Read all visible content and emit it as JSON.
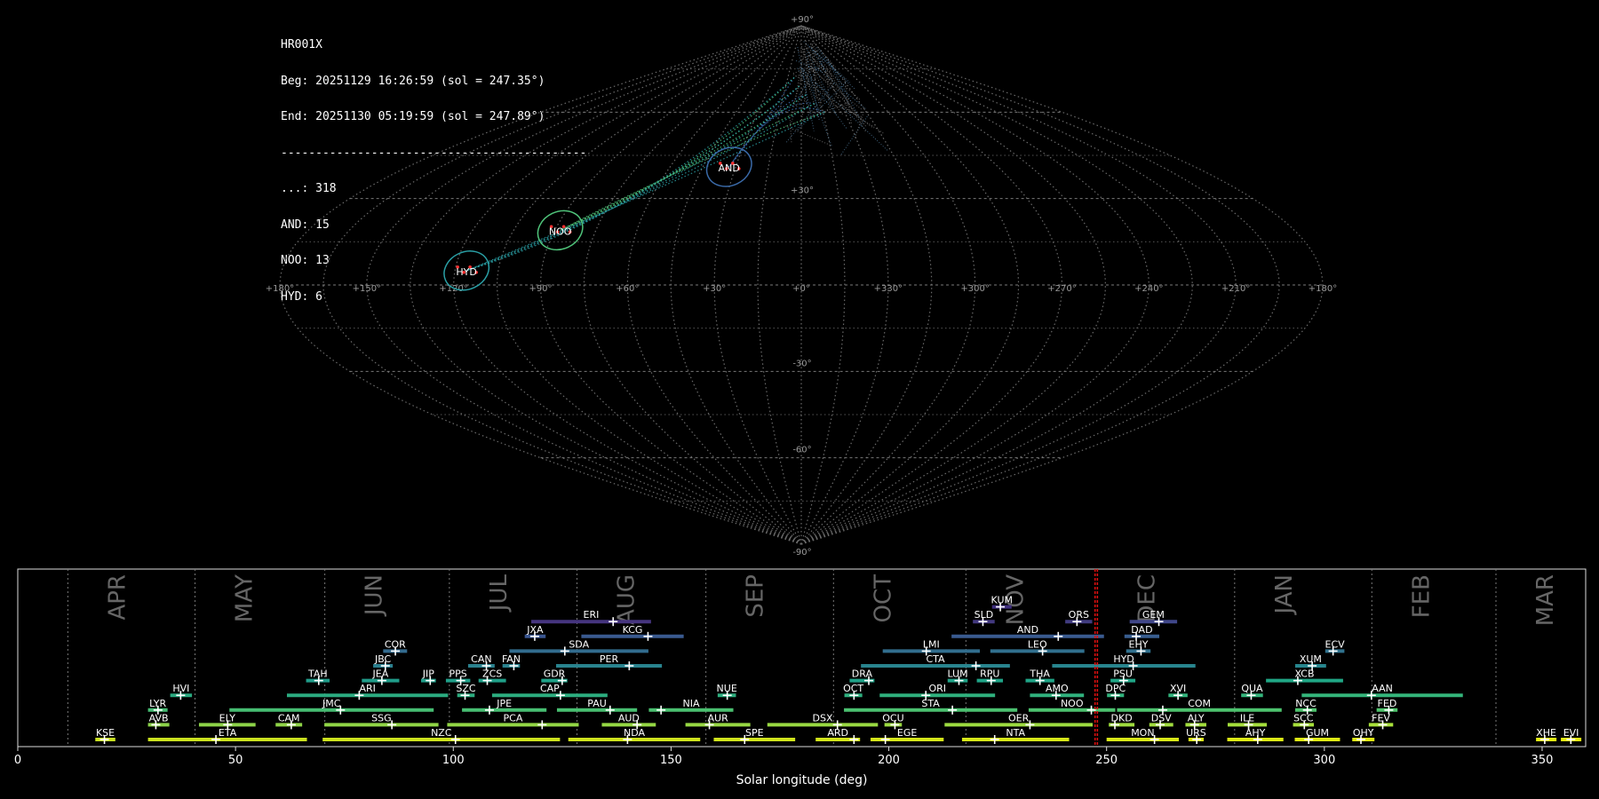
{
  "header": {
    "station": "HR001X",
    "begin": "Beg: 20251129 16:26:59 (sol = 247.35°)",
    "end": "End: 20251130 05:19:59 (sol = 247.89°)",
    "separator": "--------------------------------------------"
  },
  "chart_data": [
    {
      "type": "scatter",
      "projection": "sinusoidal",
      "counts": [
        {
          "label": "...",
          "count": 318
        },
        {
          "label": "AND",
          "count": 15
        },
        {
          "label": "NOO",
          "count": 13
        },
        {
          "label": "HYD",
          "count": 6
        }
      ],
      "radiants": [
        {
          "name": "AND",
          "lon": 33,
          "lat": 41,
          "color": "#3a6aa8"
        },
        {
          "name": "NOO",
          "lon": 88,
          "lat": 19,
          "color": "#4fc47a"
        },
        {
          "name": "HYD",
          "lon": 116,
          "lat": 5,
          "color": "#2aa0a6"
        }
      ],
      "lon_ticks": [
        "+180°",
        "+150°",
        "+120°",
        "+90°",
        "+60°",
        "+30°",
        "+0°",
        "+330°",
        "+300°",
        "+270°",
        "+240°",
        "+210°",
        "+180°"
      ],
      "lon_values": [
        180,
        150,
        120,
        90,
        60,
        30,
        0,
        -30,
        -60,
        -90,
        -120,
        -150,
        -180
      ],
      "lat_ticks": [
        "+90°",
        "+30°",
        "-30°",
        "-60°",
        "-90°"
      ],
      "lat_values": [
        90,
        30,
        -30,
        -60,
        -90
      ]
    },
    {
      "type": "timeline",
      "xlabel": "Solar longitude (deg)",
      "xlim": [
        0,
        360
      ],
      "xticks": [
        0,
        50,
        100,
        150,
        200,
        250,
        300,
        350
      ],
      "current_sol": [
        247.35,
        247.89
      ],
      "months": [
        {
          "name": "APR",
          "start": 11.5
        },
        {
          "name": "MAY",
          "start": 40.7
        },
        {
          "name": "JUN",
          "start": 70.5
        },
        {
          "name": "JUL",
          "start": 99.1
        },
        {
          "name": "AUG",
          "start": 128.4
        },
        {
          "name": "SEP",
          "start": 158.0
        },
        {
          "name": "OCT",
          "start": 187.3
        },
        {
          "name": "NOV",
          "start": 217.7
        },
        {
          "name": "DEC",
          "start": 247.9
        },
        {
          "name": "JAN",
          "start": 279.4
        },
        {
          "name": "FEB",
          "start": 310.9
        },
        {
          "name": "MAR",
          "start": 339.4
        }
      ],
      "showers": [
        {
          "code": "KUM",
          "start": 223.7,
          "end": 228.2,
          "peak": 225.6,
          "row": 9,
          "color": "#3f2f7f"
        },
        {
          "code": "ERI",
          "start": 117.9,
          "end": 145.4,
          "peak": 136.7,
          "row": 8,
          "color": "#46357f"
        },
        {
          "code": "SLD",
          "start": 219.3,
          "end": 224.3,
          "peak": 221.6,
          "row": 8,
          "color": "#433980"
        },
        {
          "code": "ORS",
          "start": 240.5,
          "end": 246.7,
          "peak": 243.2,
          "row": 8,
          "color": "#413c80"
        },
        {
          "code": "GEM",
          "start": 255.3,
          "end": 266.2,
          "peak": 262.0,
          "row": 8,
          "color": "#40478a"
        },
        {
          "code": "JXA",
          "start": 116.4,
          "end": 121.2,
          "peak": 118.7,
          "row": 7,
          "color": "#3a5690"
        },
        {
          "code": "KCG",
          "start": 129.4,
          "end": 152.9,
          "peak": 144.7,
          "row": 7,
          "color": "#3a5a90"
        },
        {
          "code": "AND",
          "start": 214.4,
          "end": 249.4,
          "peak": 238.9,
          "row": 7,
          "color": "#3a5b90"
        },
        {
          "code": "DAD",
          "start": 254.1,
          "end": 262.1,
          "peak": 256.8,
          "row": 7,
          "color": "#395e90"
        },
        {
          "code": "COR",
          "start": 83.9,
          "end": 89.4,
          "peak": 86.7,
          "row": 6,
          "color": "#336b8f"
        },
        {
          "code": "SDA",
          "start": 112.9,
          "end": 144.8,
          "peak": 125.6,
          "row": 6,
          "color": "#326c8e"
        },
        {
          "code": "LMI",
          "start": 198.6,
          "end": 220.9,
          "peak": 208.6,
          "row": 6,
          "color": "#326e8e"
        },
        {
          "code": "LEO",
          "start": 223.3,
          "end": 244.9,
          "peak": 235.3,
          "row": 6,
          "color": "#31708e"
        },
        {
          "code": "EHY",
          "start": 254.5,
          "end": 260.1,
          "peak": 257.9,
          "row": 6,
          "color": "#31718e"
        },
        {
          "code": "ECV",
          "start": 300.2,
          "end": 304.6,
          "peak": 302.0,
          "row": 6,
          "color": "#30728e"
        },
        {
          "code": "JBC",
          "start": 81.6,
          "end": 86.1,
          "peak": 84.4,
          "row": 5,
          "color": "#2b7f8e"
        },
        {
          "code": "CAN",
          "start": 103.4,
          "end": 109.5,
          "peak": 107.6,
          "row": 5,
          "color": "#2a818e"
        },
        {
          "code": "FAN",
          "start": 111.3,
          "end": 115.3,
          "peak": 113.9,
          "row": 5,
          "color": "#2a828e"
        },
        {
          "code": "PER",
          "start": 123.6,
          "end": 147.9,
          "peak": 140.4,
          "row": 5,
          "color": "#29838e"
        },
        {
          "code": "CTA",
          "start": 193.6,
          "end": 227.8,
          "peak": 220.0,
          "row": 5,
          "color": "#29848e"
        },
        {
          "code": "HYD",
          "start": 237.5,
          "end": 270.4,
          "peak": 256.1,
          "row": 5,
          "color": "#28858e"
        },
        {
          "code": "XUM",
          "start": 293.3,
          "end": 300.4,
          "peak": 297.2,
          "row": 5,
          "color": "#27868e"
        },
        {
          "code": "TAH",
          "start": 66.2,
          "end": 71.6,
          "peak": 69.1,
          "row": 4,
          "color": "#209b89"
        },
        {
          "code": "JEA",
          "start": 79.0,
          "end": 87.6,
          "peak": 83.6,
          "row": 4,
          "color": "#209c89"
        },
        {
          "code": "JIP",
          "start": 92.6,
          "end": 96.0,
          "peak": 94.7,
          "row": 4,
          "color": "#1f9d88"
        },
        {
          "code": "PPS",
          "start": 98.3,
          "end": 103.9,
          "peak": 101.7,
          "row": 4,
          "color": "#1f9e88"
        },
        {
          "code": "ZCS",
          "start": 105.8,
          "end": 112.1,
          "peak": 107.8,
          "row": 4,
          "color": "#1f9f88"
        },
        {
          "code": "GDR",
          "start": 120.2,
          "end": 126.2,
          "peak": 125.0,
          "row": 4,
          "color": "#1fa087"
        },
        {
          "code": "DRA",
          "start": 191.0,
          "end": 196.7,
          "peak": 195.4,
          "row": 4,
          "color": "#1fa187"
        },
        {
          "code": "LUM",
          "start": 213.5,
          "end": 218.1,
          "peak": 216.1,
          "row": 4,
          "color": "#1fa287"
        },
        {
          "code": "RPU",
          "start": 220.2,
          "end": 226.2,
          "peak": 223.5,
          "row": 4,
          "color": "#1fa386"
        },
        {
          "code": "THA",
          "start": 231.4,
          "end": 238.0,
          "peak": 234.7,
          "row": 4,
          "color": "#1fa486"
        },
        {
          "code": "PSU",
          "start": 250.9,
          "end": 256.6,
          "peak": 253.9,
          "row": 4,
          "color": "#20a586"
        },
        {
          "code": "XCB",
          "start": 286.6,
          "end": 304.3,
          "peak": 293.9,
          "row": 4,
          "color": "#20a685"
        },
        {
          "code": "HVI",
          "start": 35.0,
          "end": 40.0,
          "peak": 37.4,
          "row": 3,
          "color": "#2aaa80"
        },
        {
          "code": "ARI",
          "start": 61.8,
          "end": 98.8,
          "peak": 78.4,
          "row": 3,
          "color": "#2bab80"
        },
        {
          "code": "SZC",
          "start": 100.9,
          "end": 104.9,
          "peak": 102.7,
          "row": 3,
          "color": "#2cac7f"
        },
        {
          "code": "CAP",
          "start": 108.9,
          "end": 135.4,
          "peak": 124.6,
          "row": 3,
          "color": "#2cad7f"
        },
        {
          "code": "NUE",
          "start": 160.7,
          "end": 164.9,
          "peak": 162.9,
          "row": 3,
          "color": "#2dae7e"
        },
        {
          "code": "OCT",
          "start": 189.8,
          "end": 193.9,
          "peak": 192.0,
          "row": 3,
          "color": "#2eaf7e"
        },
        {
          "code": "ORI",
          "start": 197.9,
          "end": 224.4,
          "peak": 208.5,
          "row": 3,
          "color": "#2fb07d"
        },
        {
          "code": "AMO",
          "start": 232.4,
          "end": 244.8,
          "peak": 238.4,
          "row": 3,
          "color": "#30b17d"
        },
        {
          "code": "DPC",
          "start": 250.1,
          "end": 254.0,
          "peak": 252.0,
          "row": 3,
          "color": "#31b27c"
        },
        {
          "code": "XVI",
          "start": 264.2,
          "end": 268.6,
          "peak": 266.4,
          "row": 3,
          "color": "#32b37c"
        },
        {
          "code": "QUA",
          "start": 280.9,
          "end": 285.9,
          "peak": 283.2,
          "row": 3,
          "color": "#33b47b"
        },
        {
          "code": "AAN",
          "start": 294.8,
          "end": 331.8,
          "peak": 310.8,
          "row": 3,
          "color": "#34b57b"
        },
        {
          "code": "LYR",
          "start": 29.9,
          "end": 34.4,
          "peak": 32.2,
          "row": 2,
          "color": "#45bc73"
        },
        {
          "code": "JMC",
          "start": 48.6,
          "end": 95.5,
          "peak": 74.1,
          "row": 2,
          "color": "#46bd72"
        },
        {
          "code": "JPE",
          "start": 102.0,
          "end": 121.4,
          "peak": 108.3,
          "row": 2,
          "color": "#47be72"
        },
        {
          "code": "PAU",
          "start": 123.8,
          "end": 142.2,
          "peak": 136.0,
          "row": 2,
          "color": "#48bf71"
        },
        {
          "code": "NIA",
          "start": 144.9,
          "end": 164.3,
          "peak": 147.7,
          "row": 2,
          "color": "#4ac070"
        },
        {
          "code": "STA",
          "start": 189.7,
          "end": 229.5,
          "peak": 214.6,
          "row": 2,
          "color": "#4bc170"
        },
        {
          "code": "NOO",
          "start": 232.1,
          "end": 252.0,
          "peak": 246.5,
          "row": 2,
          "color": "#4cc26f"
        },
        {
          "code": "COM",
          "start": 252.4,
          "end": 290.2,
          "peak": 262.9,
          "row": 2,
          "color": "#4dc36e"
        },
        {
          "code": "NCC",
          "start": 293.3,
          "end": 298.2,
          "peak": 296.1,
          "row": 2,
          "color": "#4ec46e"
        },
        {
          "code": "FED",
          "start": 312.0,
          "end": 316.8,
          "peak": 314.8,
          "row": 2,
          "color": "#4fc56d"
        },
        {
          "code": "AVB",
          "start": 29.9,
          "end": 34.8,
          "peak": 31.7,
          "row": 1,
          "color": "#8bd249"
        },
        {
          "code": "ELY",
          "start": 41.6,
          "end": 54.6,
          "peak": 48.2,
          "row": 1,
          "color": "#8dd348"
        },
        {
          "code": "CAM",
          "start": 59.2,
          "end": 65.3,
          "peak": 62.8,
          "row": 1,
          "color": "#8fd447"
        },
        {
          "code": "SSG",
          "start": 70.4,
          "end": 96.6,
          "peak": 85.9,
          "row": 1,
          "color": "#91d546"
        },
        {
          "code": "PCA",
          "start": 98.6,
          "end": 128.8,
          "peak": 120.4,
          "row": 1,
          "color": "#93d645"
        },
        {
          "code": "AUD",
          "start": 134.1,
          "end": 146.5,
          "peak": 142.2,
          "row": 1,
          "color": "#95d744"
        },
        {
          "code": "AUR",
          "start": 153.3,
          "end": 168.2,
          "peak": 158.8,
          "row": 1,
          "color": "#97d843"
        },
        {
          "code": "DSX",
          "start": 172.1,
          "end": 197.5,
          "peak": 188.2,
          "row": 1,
          "color": "#99d942"
        },
        {
          "code": "OCU",
          "start": 199.0,
          "end": 203.0,
          "peak": 201.4,
          "row": 1,
          "color": "#9bda41"
        },
        {
          "code": "OER",
          "start": 212.8,
          "end": 246.8,
          "peak": 232.4,
          "row": 1,
          "color": "#9ddb40"
        },
        {
          "code": "DKD",
          "start": 250.5,
          "end": 256.4,
          "peak": 251.9,
          "row": 1,
          "color": "#9fdc3f"
        },
        {
          "code": "DSV",
          "start": 259.8,
          "end": 265.3,
          "peak": 262.3,
          "row": 1,
          "color": "#a1dd3e"
        },
        {
          "code": "ALY",
          "start": 268.1,
          "end": 272.9,
          "peak": 270.2,
          "row": 1,
          "color": "#a3de3d"
        },
        {
          "code": "ILE",
          "start": 277.8,
          "end": 286.8,
          "peak": 282.6,
          "row": 1,
          "color": "#a5df3c"
        },
        {
          "code": "SCC",
          "start": 292.8,
          "end": 297.6,
          "peak": 295.4,
          "row": 1,
          "color": "#a7e03b"
        },
        {
          "code": "FEV",
          "start": 310.2,
          "end": 315.8,
          "peak": 313.4,
          "row": 1,
          "color": "#a9e13a"
        },
        {
          "code": "KSE",
          "start": 17.8,
          "end": 22.4,
          "peak": 19.9,
          "row": 0,
          "color": "#c8e020"
        },
        {
          "code": "ETA",
          "start": 29.9,
          "end": 66.4,
          "peak": 45.5,
          "row": 0,
          "color": "#cae11f"
        },
        {
          "code": "NZC",
          "start": 70.0,
          "end": 124.5,
          "peak": 100.5,
          "row": 0,
          "color": "#cce21e"
        },
        {
          "code": "NDA",
          "start": 126.4,
          "end": 156.7,
          "peak": 140.0,
          "row": 0,
          "color": "#cee31d"
        },
        {
          "code": "SPE",
          "start": 159.8,
          "end": 178.5,
          "peak": 166.9,
          "row": 0,
          "color": "#d0e41c"
        },
        {
          "code": "ARD",
          "start": 183.2,
          "end": 193.4,
          "peak": 192.0,
          "row": 0,
          "color": "#d2e51b"
        },
        {
          "code": "EGE",
          "start": 195.8,
          "end": 212.6,
          "peak": 199.2,
          "row": 0,
          "color": "#d4e61a"
        },
        {
          "code": "NTA",
          "start": 216.8,
          "end": 241.4,
          "peak": 224.3,
          "row": 0,
          "color": "#d6e719"
        },
        {
          "code": "MON",
          "start": 250.0,
          "end": 266.6,
          "peak": 261.0,
          "row": 0,
          "color": "#d8e818"
        },
        {
          "code": "URS",
          "start": 268.8,
          "end": 272.3,
          "peak": 270.7,
          "row": 0,
          "color": "#dae917"
        },
        {
          "code": "AHY",
          "start": 277.7,
          "end": 290.6,
          "peak": 284.7,
          "row": 0,
          "color": "#dcea16"
        },
        {
          "code": "GUM",
          "start": 293.2,
          "end": 303.6,
          "peak": 296.4,
          "row": 0,
          "color": "#deeb15"
        },
        {
          "code": "OHY",
          "start": 306.4,
          "end": 311.5,
          "peak": 308.4,
          "row": 0,
          "color": "#e0ec14"
        },
        {
          "code": "XHE",
          "start": 348.6,
          "end": 353.3,
          "peak": 350.6,
          "row": 0,
          "color": "#e2ed13"
        },
        {
          "code": "EVI",
          "start": 354.3,
          "end": 359.0,
          "peak": 356.6,
          "row": 0,
          "color": "#e4ee12"
        }
      ]
    }
  ]
}
